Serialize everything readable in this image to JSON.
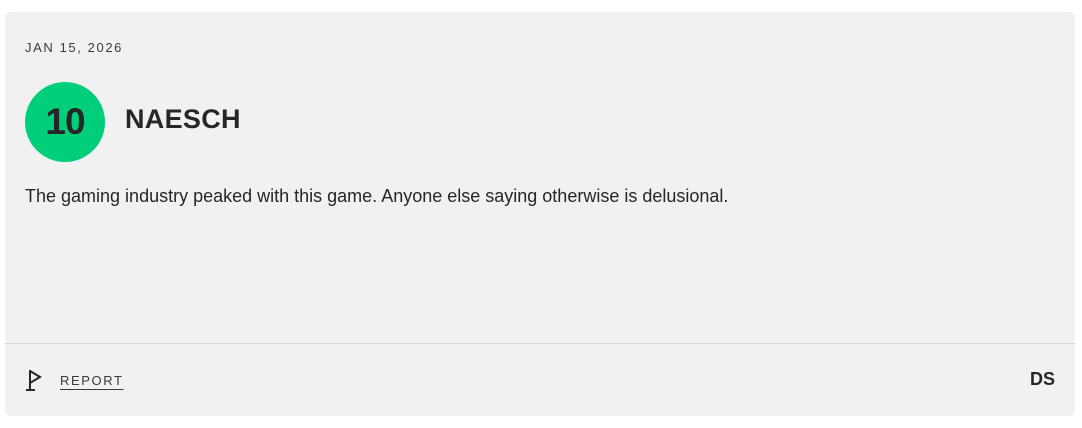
{
  "review": {
    "date": "JAN 15, 2026",
    "score": "10",
    "username": "NAESCH",
    "text": "The gaming industry peaked with this game. Anyone else saying otherwise is delusional.",
    "score_color": "#00ce7a"
  },
  "footer": {
    "report_label": "REPORT",
    "report_icon": "flag-icon",
    "platform": "DS"
  }
}
